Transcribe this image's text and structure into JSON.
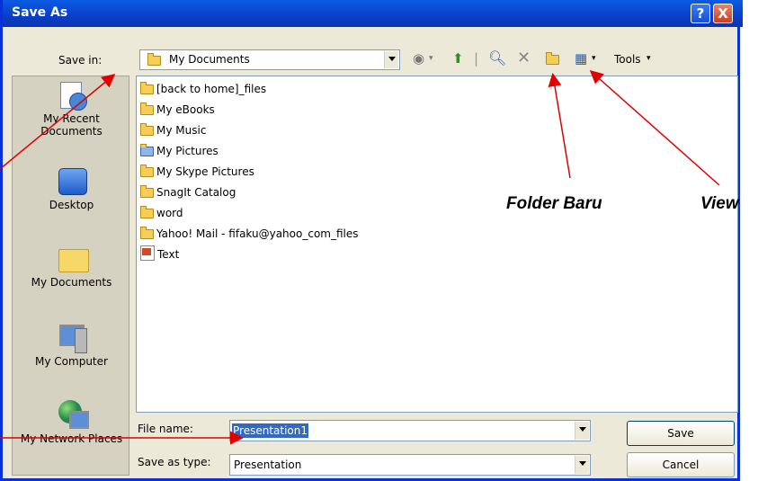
{
  "window": {
    "title": "Save As",
    "help_label": "?",
    "close_label": "X"
  },
  "save_in": {
    "label": "Save in:",
    "value": "My Documents"
  },
  "toolbar": {
    "tools_label": "Tools"
  },
  "places": [
    {
      "label": "My Recent Documents"
    },
    {
      "label": "Desktop"
    },
    {
      "label": "My Documents"
    },
    {
      "label": "My Computer"
    },
    {
      "label": "My Network Places"
    }
  ],
  "files": [
    {
      "name": "[back to home]_files",
      "icon": "folder-icon"
    },
    {
      "name": "My eBooks",
      "icon": "folder-icon"
    },
    {
      "name": "My Music",
      "icon": "music-folder-icon"
    },
    {
      "name": "My Pictures",
      "icon": "pictures-folder-icon"
    },
    {
      "name": "My Skype Pictures",
      "icon": "folder-icon"
    },
    {
      "name": "SnagIt Catalog",
      "icon": "folder-icon"
    },
    {
      "name": "word",
      "icon": "folder-icon"
    },
    {
      "name": "Yahoo! Mail - fifaku@yahoo_com_files",
      "icon": "folder-icon"
    },
    {
      "name": "Text",
      "icon": "presentation-file-icon"
    }
  ],
  "file_name": {
    "label": "File name:",
    "value": "Presentation1"
  },
  "save_as_type": {
    "label": "Save as type:",
    "value": "Presentation"
  },
  "buttons": {
    "save": "Save",
    "cancel": "Cancel"
  },
  "annotations": {
    "new_folder": "Folder Baru",
    "view": "View"
  },
  "colors": {
    "title_bar": "#0a3fc8",
    "dialog_bg": "#ece9d8",
    "arrow": "#e00000",
    "selection": "#316ac5"
  }
}
